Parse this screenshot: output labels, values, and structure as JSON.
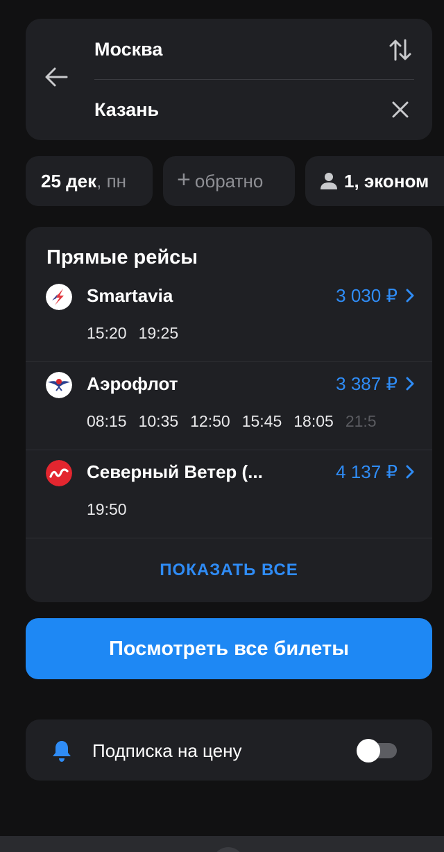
{
  "route": {
    "from": "Москва",
    "to": "Казань"
  },
  "chips": {
    "date_day": "25 дек",
    "date_weekday": ", пн",
    "return_label": "обратно",
    "passengers": "1, эконом"
  },
  "flights": {
    "title": "Прямые рейсы",
    "items": [
      {
        "airline": "Smartavia",
        "price": "3 030 ₽",
        "times": [
          "15:20",
          "19:25"
        ]
      },
      {
        "airline": "Аэрофлот",
        "price": "3 387 ₽",
        "times": [
          "08:15",
          "10:35",
          "12:50",
          "15:45",
          "18:05",
          "21:5"
        ]
      },
      {
        "airline": "Северный Ветер (...",
        "price": "4 137 ₽",
        "times": [
          "19:50"
        ]
      }
    ],
    "show_all": "ПОКАЗАТЬ ВСЕ"
  },
  "all_tickets_button": "Посмотреть все билеты",
  "subscription": {
    "label": "Подписка на цену",
    "enabled": false
  },
  "colors": {
    "accent": "#2f8cf6",
    "button": "#1e88f4",
    "card": "#1f2024",
    "background": "#111112"
  },
  "icons": {
    "back": "arrow-left-icon",
    "swap": "swap-vertical-icon",
    "clear": "close-icon",
    "passenger": "person-icon",
    "chevron": "chevron-right-icon",
    "bell": "bell-icon"
  }
}
